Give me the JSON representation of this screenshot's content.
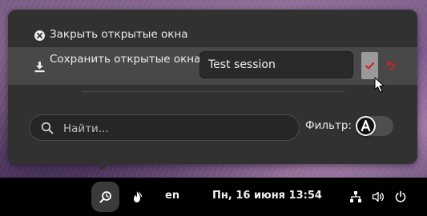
{
  "menu": {
    "close_label": "Закрыть открытые окна",
    "save_label": "Сохранить открытые окна",
    "session_name_value": "Test session"
  },
  "search": {
    "placeholder": "Найти..."
  },
  "filter": {
    "label": "Фильтр:",
    "knob_glyph": "A",
    "enabled": false
  },
  "taskbar": {
    "keyboard_layout": "en",
    "clock": "Пн, 16 июня  13:54"
  },
  "colors": {
    "popup_bg": "#313131",
    "selected_row_bg": "#484848",
    "confirm_check": "#d02020",
    "undo_arrow": "#d02020",
    "taskbar_bg": "#000000"
  },
  "icons": {
    "close": "close-circle-icon",
    "save": "download-icon",
    "confirm": "checkmark-icon",
    "undo": "undo-icon",
    "search": "search-icon",
    "app_active": "session-manager-icon",
    "flame": "flame-icon",
    "network": "network-icon",
    "volume": "volume-icon",
    "power": "power-icon"
  }
}
